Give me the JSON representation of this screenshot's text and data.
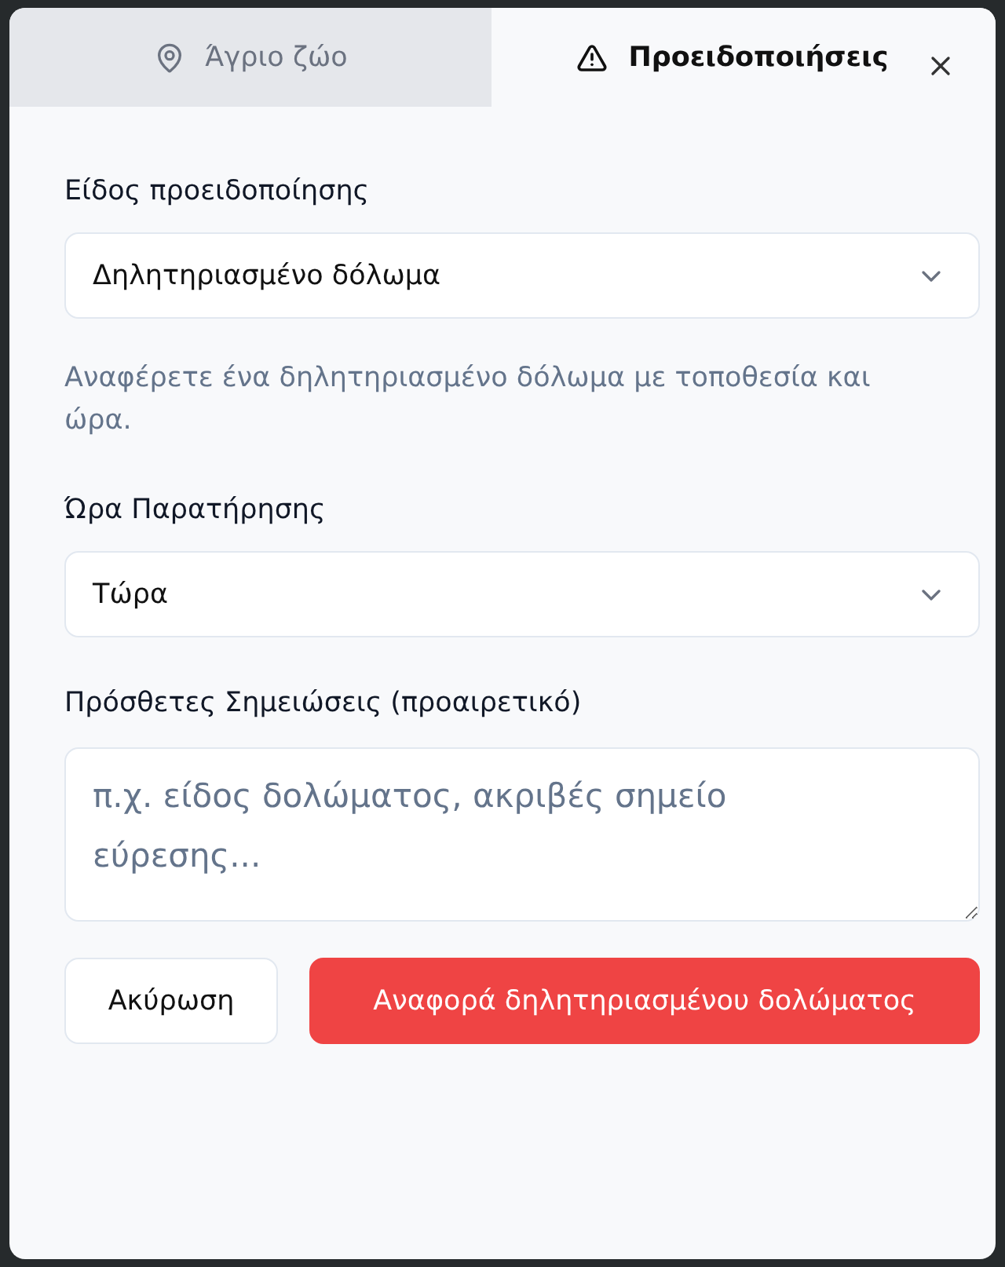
{
  "tabs": [
    {
      "label": "Άγριο ζώο",
      "selected": false
    },
    {
      "label": "Προειδοποιήσεις",
      "selected": true
    }
  ],
  "form": {
    "fields": [
      {
        "kind": "select",
        "label": "Είδος προειδοποίησης",
        "value": "Δηλητηριασμένο δόλωμα",
        "help": "Αναφέρετε ένα δηλητηριασμένο δόλωμα με τοποθεσία και ώρα."
      },
      {
        "kind": "select",
        "label": "Ώρα Παρατήρησης",
        "value": "Τώρα"
      },
      {
        "kind": "textarea",
        "label": "Πρόσθετες Σημειώσεις (προαιρετικό)",
        "placeholder": "π.χ. είδος δολώματος, ακριβές σημείο εύρεσης..."
      }
    ]
  },
  "buttons": [
    {
      "kind": "secondary",
      "label": "Ακύρωση"
    },
    {
      "kind": "primary",
      "label": "Αναφορά δηλητηριασμένου δολώματος"
    }
  ]
}
